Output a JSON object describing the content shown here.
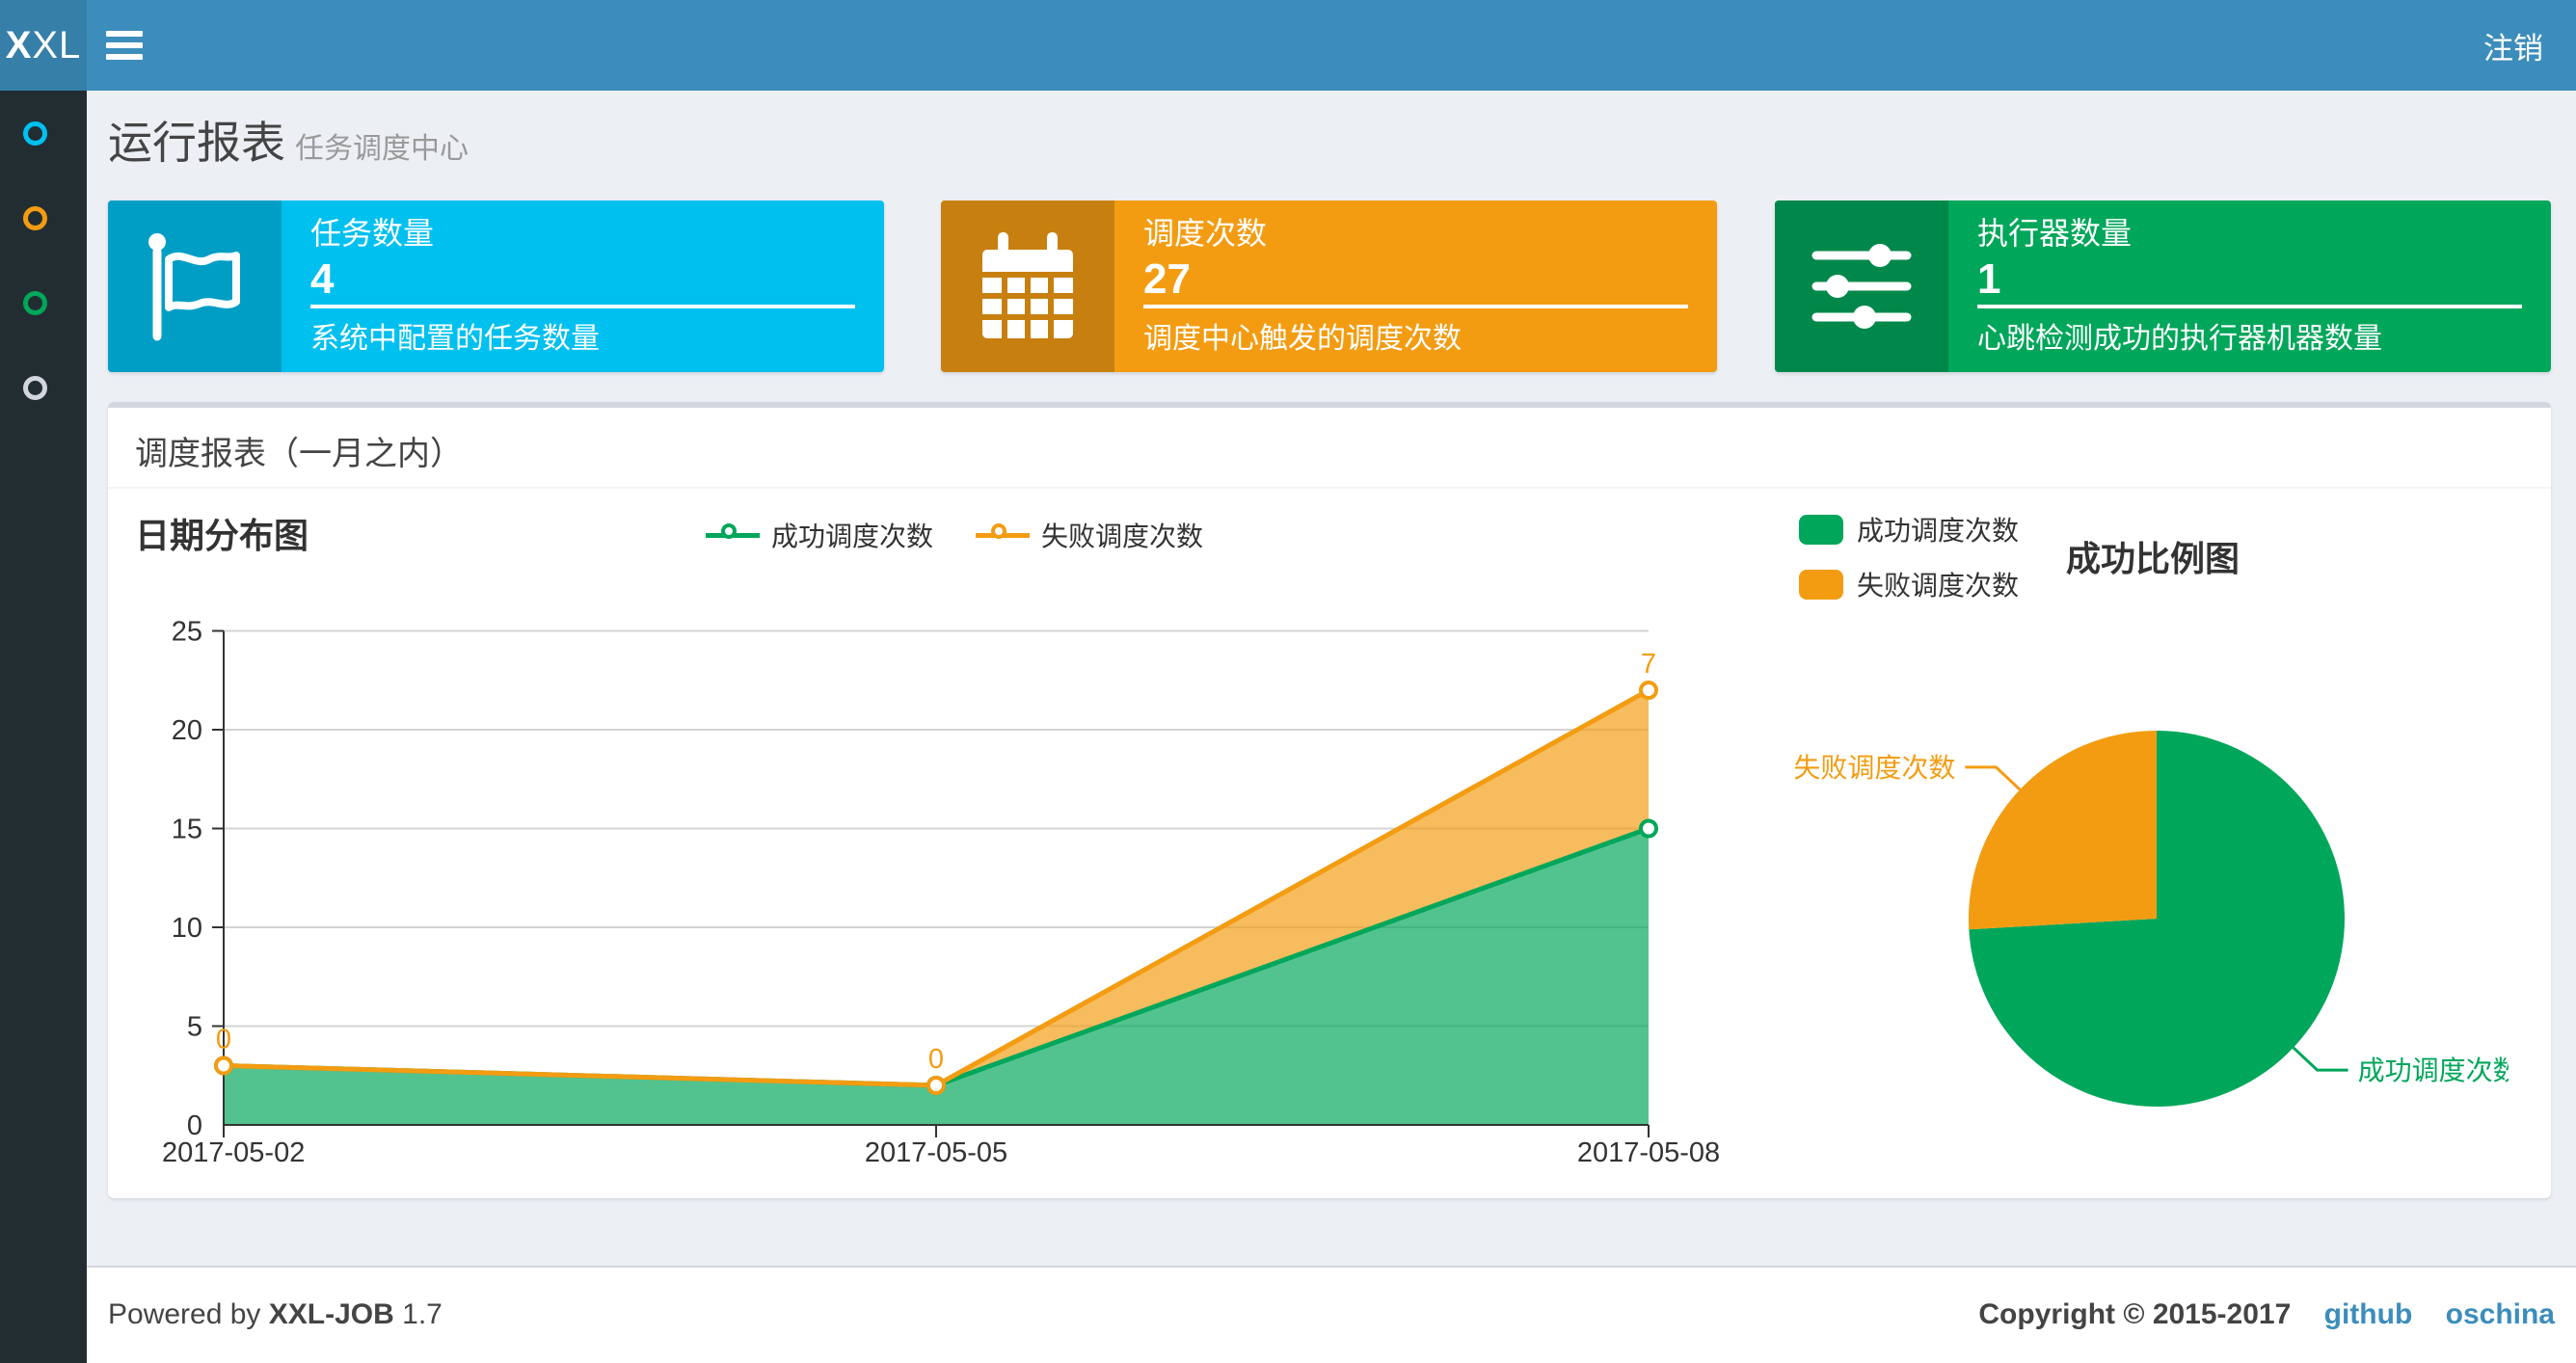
{
  "navbar": {
    "logo_bold": "X",
    "logo_rest": "XL",
    "logout": "注销"
  },
  "sidebar": {
    "items": [
      {
        "icon": "circle-icon",
        "color": "#00c0ef"
      },
      {
        "icon": "circle-icon",
        "color": "#f39c12"
      },
      {
        "icon": "circle-icon",
        "color": "#00a65a"
      },
      {
        "icon": "circle-icon",
        "color": "#d2d6de"
      }
    ]
  },
  "page_header": {
    "title": "运行报表",
    "subtitle": "任务调度中心"
  },
  "info_boxes": [
    {
      "label": "任务数量",
      "value": "4",
      "desc": "系统中配置的任务数量",
      "color": "#00c0ef",
      "icon_bg": "#009ec4",
      "icon": "flag-icon"
    },
    {
      "label": "调度次数",
      "value": "27",
      "desc": "调度中心触发的调度次数",
      "color": "#f39c12",
      "icon_bg": "#c7800f",
      "icon": "calendar-icon"
    },
    {
      "label": "执行器数量",
      "value": "1",
      "desc": "心跳检测成功的执行器机器数量",
      "color": "#00a65a",
      "icon_bg": "#00884a",
      "icon": "sliders-icon"
    }
  ],
  "panel": {
    "title": "调度报表（一月之内）"
  },
  "chart_data": [
    {
      "type": "area",
      "title": "日期分布图",
      "x": [
        "2017-05-02",
        "2017-05-05",
        "2017-05-08"
      ],
      "series": [
        {
          "name": "成功调度次数",
          "color": "#00A65A",
          "values": [
            3,
            2,
            15
          ]
        },
        {
          "name": "失败调度次数",
          "color": "#F39C12",
          "values": [
            0,
            0,
            7
          ],
          "point_labels": [
            "0",
            "0",
            "7"
          ]
        }
      ],
      "stacked": true,
      "xlabel": "",
      "ylabel": "",
      "ylim": [
        0,
        25
      ],
      "yticks": [
        0,
        5,
        10,
        15,
        20,
        25
      ],
      "grid": true,
      "legend_position": "top-center"
    },
    {
      "type": "pie",
      "title": "成功比例图",
      "slices": [
        {
          "name": "成功调度次数",
          "value": 20,
          "color": "#00A65A"
        },
        {
          "name": "失败调度次数",
          "value": 7,
          "color": "#F39C12"
        }
      ],
      "legend_position": "top-left"
    }
  ],
  "footer": {
    "powered_prefix": "Powered by",
    "app_name": "XXL-JOB",
    "version": "1.7",
    "copyright": "Copyright © 2015-2017",
    "links": [
      {
        "label": "github"
      },
      {
        "label": "oschina"
      }
    ]
  }
}
